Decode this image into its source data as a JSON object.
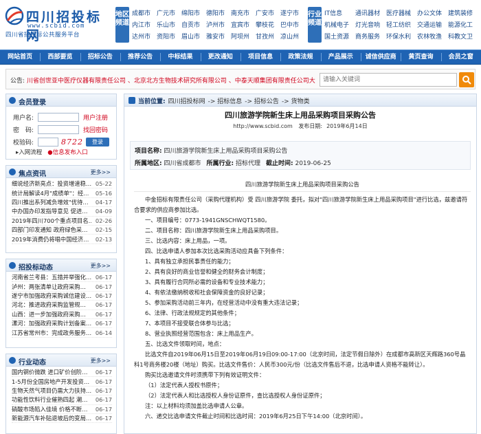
{
  "logo": {
    "title": "四川招投标网",
    "url": "www.scbid.com",
    "slogan": "四川省招投标公共服务平台"
  },
  "region_label": "地区频道",
  "industry_label": "行业频道",
  "regions": [
    [
      "成都市",
      "广元市",
      "绵阳市",
      "德阳市",
      "南充市",
      "广安市",
      "遂宁市"
    ],
    [
      "内江市",
      "乐山市",
      "自贡市",
      "泸州市",
      "宜宾市",
      "攀枝花",
      "巴中市"
    ],
    [
      "达州市",
      "资阳市",
      "眉山市",
      "雅安市",
      "阿坝州",
      "甘孜州",
      "凉山州"
    ]
  ],
  "industries": [
    [
      "IT信息",
      "通讯器材",
      "医疗器械",
      "办公文体",
      "建筑装修"
    ],
    [
      "机械电子",
      "灯光音响",
      "轻工纺织",
      "交通运输",
      "能源化工"
    ],
    [
      "国土资源",
      "商务服务",
      "环保水利",
      "农林牧渔",
      "科教文卫"
    ]
  ],
  "nav": [
    "网站首页",
    "西部要览",
    "招标公告",
    "推荐公告",
    "中标结果",
    "更改通知",
    "项目信息",
    "政策法规",
    "产品展示",
    "诚信供应商",
    "黄页查询",
    "会员之窗"
  ],
  "notice": {
    "label": "公告:",
    "text": "川省创世亚中医疗仪器有限责任公司 、北京北方生物技术研究所有限公司 、中泰天顺集团有限责任公司大",
    "search_placeholder": "请输入关键词"
  },
  "login": {
    "title": "会员登录",
    "username_label": "用户名:",
    "password_label": "密　码:",
    "code_label": "校验码:",
    "register": "用户注册",
    "recover": "找回密码",
    "code": "8722",
    "login_btn": "登录",
    "link_flow": "入网流程",
    "link_publish": "信息发布入口"
  },
  "hot": {
    "title": "焦点资讯",
    "more": "更多>>",
    "items": [
      {
        "t": "细说经济新亮点：投资增速稳…",
        "d": "05-22"
      },
      {
        "t": "统计局解读4月\"成绩单\"：经…",
        "d": "05-16"
      },
      {
        "t": "四川推出系列减负增效\"优待…",
        "d": "04-17"
      },
      {
        "t": "中办国办印发指导意见 促进…",
        "d": "04-09"
      },
      {
        "t": "2019年四川700个重点项目名…",
        "d": "02-26"
      },
      {
        "t": "四部门印发通知 政府绿色采…",
        "d": "02-15"
      },
      {
        "t": "2019年消费仍将唱中国经济…",
        "d": "02-13"
      }
    ]
  },
  "bid": {
    "title": "招投标动态",
    "more": "更多>>",
    "items": [
      {
        "t": "河南省兰考县：五措并举强化…",
        "d": "06-17"
      },
      {
        "t": "泸州：两张清单让政府采购…",
        "d": "06-17"
      },
      {
        "t": "遂宁市加强政府采购诚信建设…",
        "d": "06-17"
      },
      {
        "t": "河北：推进政府采购监管规…",
        "d": "06-17"
      },
      {
        "t": "山西：进一步加强政府采购…",
        "d": "06-17"
      },
      {
        "t": "漯河：加强政府采购计划备案…",
        "d": "06-17"
      },
      {
        "t": "江苏省常州市：完成政务服务…",
        "d": "06-14"
      }
    ]
  },
  "industry_news": {
    "title": "行业动态",
    "more": "更多>>",
    "items": [
      {
        "t": "国内钢价微跌 进口矿价创阶…",
        "d": "06-17"
      },
      {
        "t": "1-5月份全国房地产开发投资…",
        "d": "06-17"
      },
      {
        "t": "生物天然气项目仍需大力扶持…",
        "d": "06-17"
      },
      {
        "t": "功能性饮料行业催熟四起 潮…",
        "d": "06-17"
      },
      {
        "t": "硝酸市场陷入佳境 价格不断…",
        "d": "06-17"
      },
      {
        "t": "新能源汽车补贴退坡后的变局…",
        "d": "06-17"
      }
    ]
  },
  "crumb": {
    "lead": "当前位置:",
    "path": [
      "四川招投标网",
      "-> 招标信息",
      "-> 招标公告",
      "-> 货物类"
    ]
  },
  "article": {
    "title": "四川旅游学院新生床上用品采购项目采购公告",
    "source": "http://www.scbid.com",
    "date_label": "发布日期:",
    "date": "2019年6月14日",
    "project_label": "项目名称:",
    "project": "四川旅游学院新生床上用品采购项目采购公告",
    "region_label": "所属地区:",
    "region": "四川省成都市",
    "industry_label": "所属行业:",
    "industry": "招标代理",
    "deadline_label": "截止时间:",
    "deadline": "2019-06-25",
    "body_title": "四川旅游学院新生床上用品采购项目采购公告",
    "intro": "中金招标有限责任公司（采购代理机构）受 四川旅游学院 委托，拟对\"四川旅游学院新生床上用品采购项目\"进行比选，兹邀请符合要求的供应商参加比选。",
    "lines": [
      "一、项目编号：0773-1941GNSCHWQT1580。",
      "二、项目名称：四川旅游学院新生床上用品采购项目。",
      "三、比选内容：床上用品，一项。",
      "四、比选申请人参加本次比选采购活动应具备下列条件：",
      "1、具有独立承担民事责任的能力；",
      "2、具有良好的商业信誉和健全的财务会计制度；",
      "3、具有履行合同所必需的设备和专业技术能力；",
      "4、有依法缴纳税收和社会保障资金的良好记录；",
      "5、参加采购活动前三年内，在经营活动中没有重大违法记录；",
      "6、法律、行政法规规定的其他条件；",
      "7、本项目不接受联合体参与比选；",
      "8、营业执照经营范围包含：床上用品生产。",
      "五、比选文件领取时间，地点：",
      "比选文件自2019年06月15日至2019年06月19日09:00-17:00（北京时间，法定节假日除外）在成都市高新区天辉路360号晶科1号商务楼20楼（地址）购买。比选文件售价：人民币300元/份（比选文件售后不退，比选申请人资格不能转让）。",
      "购买比选邀请文件时须携带下列有效证明文件：",
      "（1）法定代表人授权书原件；",
      "（2）法定代表人和比选授权人身份证原件，查比选授权人身份证原件；",
      "注：以上材料均须加盖比选申请人公章。",
      "六、递交比选申请文件截止时间和比选时间：2019年6月25日下午14:00（北京时间）。"
    ]
  }
}
